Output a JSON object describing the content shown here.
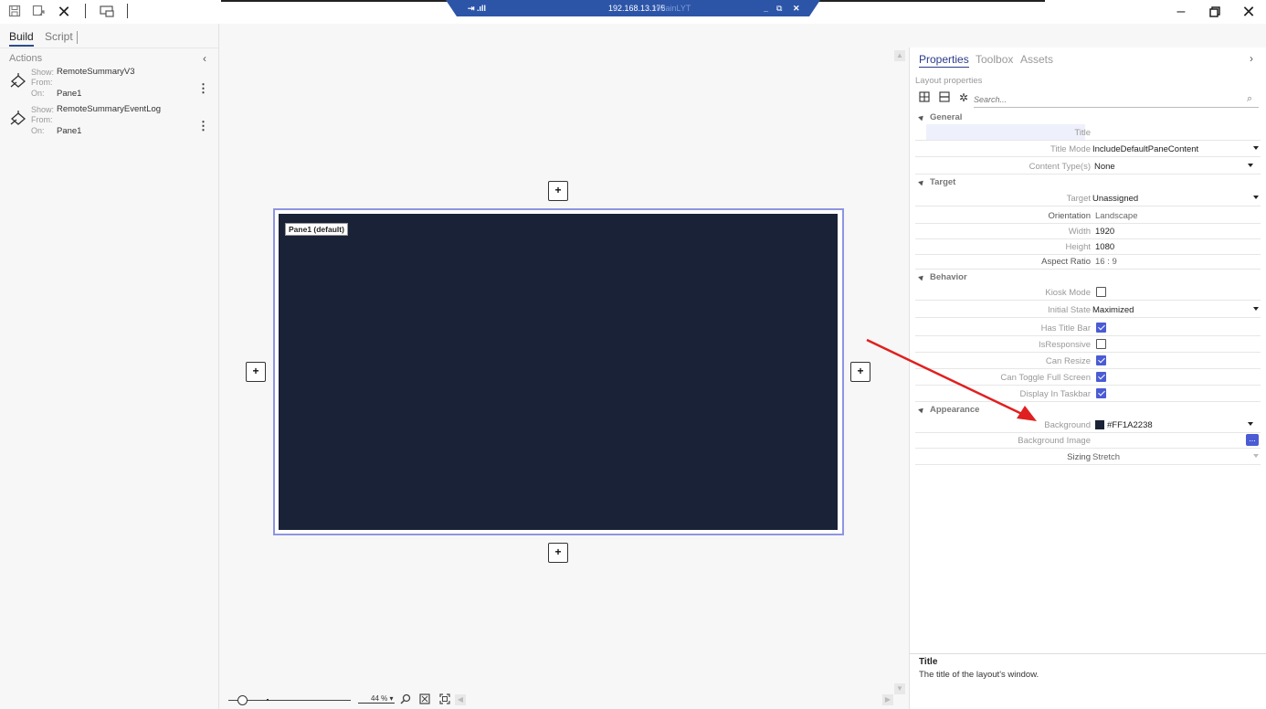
{
  "remote_bar": {
    "ip": "192.168.13.175",
    "ghost_title": "nMainLYT"
  },
  "left_panel": {
    "tabs": [
      {
        "label": "Build",
        "active": true
      },
      {
        "label": "Script",
        "active": false
      }
    ],
    "actions_title": "Actions",
    "actions": [
      {
        "show_label": "Show:",
        "show_value": "RemoteSummaryV3",
        "from_label": "From:",
        "from_value": "",
        "on_label": "On:",
        "on_value": "Pane1"
      },
      {
        "show_label": "Show:",
        "show_value": "RemoteSummaryEventLog",
        "from_label": "From:",
        "from_value": "",
        "on_label": "On:",
        "on_value": "Pane1"
      }
    ]
  },
  "canvas": {
    "pane_label": "Pane1 (default)",
    "pane_color": "#1A2238",
    "add_symbol": "+",
    "zoom_label": "44 %"
  },
  "properties": {
    "tabs": [
      {
        "label": "Properties",
        "active": true
      },
      {
        "label": "Toolbox",
        "active": false
      },
      {
        "label": "Assets",
        "active": false
      }
    ],
    "subtitle": "Layout properties",
    "search_placeholder": "Search...",
    "groups": {
      "general": "General",
      "target": "Target",
      "behavior": "Behavior",
      "appearance": "Appearance"
    },
    "rows": {
      "title": {
        "name": "Title",
        "value": ""
      },
      "title_mode": {
        "name": "Title Mode",
        "value": "IncludeDefaultPaneContent"
      },
      "content_types": {
        "name": "Content Type(s)",
        "value": "None"
      },
      "target": {
        "name": "Target",
        "value": "Unassigned"
      },
      "orientation": {
        "name": "Orientation",
        "value": "Landscape"
      },
      "width": {
        "name": "Width",
        "value": "1920"
      },
      "height": {
        "name": "Height",
        "value": "1080"
      },
      "aspect_ratio": {
        "name": "Aspect Ratio",
        "value": "16 : 9"
      },
      "kiosk_mode": {
        "name": "Kiosk Mode",
        "checked": false
      },
      "initial_state": {
        "name": "Initial State",
        "value": "Maximized"
      },
      "has_title_bar": {
        "name": "Has Title Bar",
        "checked": true
      },
      "is_responsive": {
        "name": "IsResponsive",
        "checked": false
      },
      "can_resize": {
        "name": "Can Resize",
        "checked": true
      },
      "can_toggle_full_screen": {
        "name": "Can Toggle Full Screen",
        "checked": true
      },
      "display_in_taskbar": {
        "name": "Display In Taskbar",
        "checked": true
      },
      "background": {
        "name": "Background",
        "value": "#FF1A2238",
        "swatch": "#1A2238"
      },
      "background_image": {
        "name": "Background Image",
        "value": "",
        "button": "..."
      },
      "sizing": {
        "name": "Sizing",
        "value": "Stretch"
      }
    },
    "description": {
      "title": "Title",
      "text": "The title of the layout's window."
    }
  },
  "colors": {
    "accent": "#4A5BD4",
    "annotation_arrow": "#E02020",
    "pane_outline": "#8E95E2"
  }
}
